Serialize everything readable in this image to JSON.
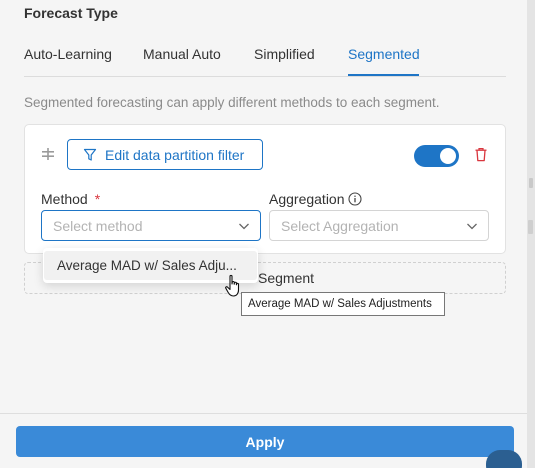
{
  "section_title": "Forecast Type",
  "tabs": [
    {
      "label": "Auto-Learning",
      "active": false
    },
    {
      "label": "Manual Auto",
      "active": false
    },
    {
      "label": "Simplified",
      "active": false
    },
    {
      "label": "Segmented",
      "active": true
    }
  ],
  "description": "Segmented forecasting can apply different methods to each segment.",
  "segment_card": {
    "filter_button_label": "Edit data partition filter",
    "toggle_on": true,
    "method": {
      "label": "Method",
      "required_mark": "*",
      "placeholder": "Select method"
    },
    "aggregation": {
      "label": "Aggregation",
      "placeholder": "Select Aggregation"
    }
  },
  "add_segment_label": "Segment",
  "method_dropdown": {
    "options": [
      "Average MAD w/ Sales Adju..."
    ]
  },
  "tooltip": "Average MAD w/ Sales Adjustments",
  "apply_label": "Apply",
  "colors": {
    "accent": "#1e75c6",
    "apply_button": "#3a8ad8",
    "danger": "#d9363e"
  },
  "icons": [
    "drag-handle-icon",
    "filter-icon",
    "trash-icon",
    "info-icon",
    "chevron-down-icon",
    "hand-pointer-icon"
  ]
}
